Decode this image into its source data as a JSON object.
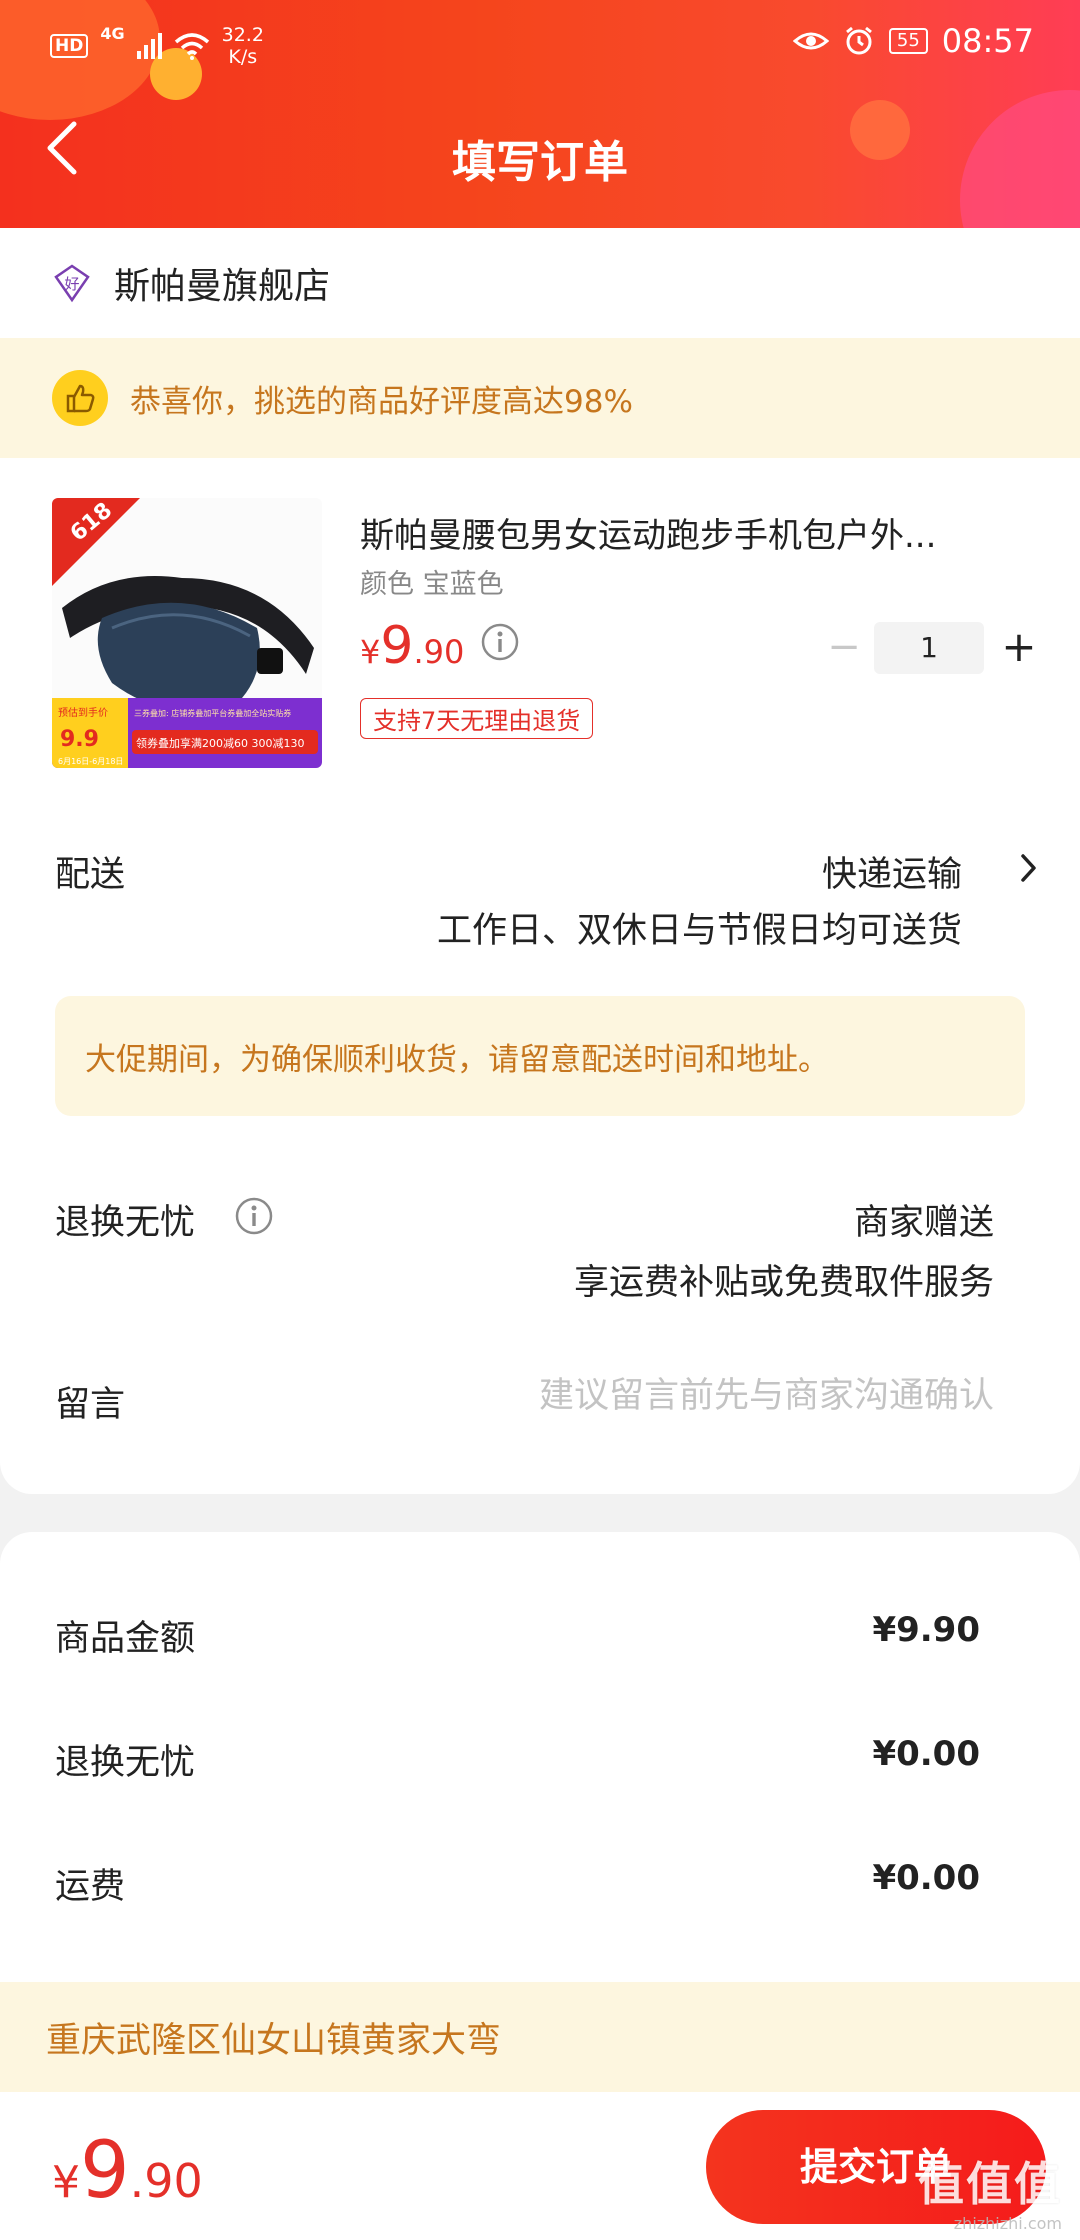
{
  "status_bar": {
    "hd": "HD",
    "network": "4G",
    "speed_value": "32.2",
    "speed_unit": "K/s",
    "battery": "55",
    "time": "08:57"
  },
  "nav": {
    "title": "填写订单"
  },
  "shop": {
    "name": "斯帕曼旗舰店",
    "badge_char": "好"
  },
  "praise": {
    "text": "恭喜你，挑选的商品好评度高达98%"
  },
  "product": {
    "title": "斯帕曼腰包男女运动跑步手机包户外...",
    "spec": "颜色 宝蓝色",
    "price_currency": "¥",
    "price_int": "9",
    "price_dec": ".90",
    "return_tag": "支持7天无理由退货",
    "quantity": "1",
    "image_texts": {
      "badge": "618",
      "deal_label": "预估到手价",
      "deal_price": "9.9",
      "banner_top": "三券叠加: 店铺券叠加平台券叠加全站实贴券",
      "banner_bottom": "领券叠加享满200减60 300减130",
      "dates": "6月16日-6月18日"
    }
  },
  "delivery": {
    "label": "配送",
    "value": "快递运输",
    "sub": "工作日、双休日与节假日均可送货",
    "notice": "大促期间，为确保顺利收货，请留意配送时间和地址。"
  },
  "returns": {
    "label": "退换无忧",
    "value": "商家赠送",
    "sub": "享运费补贴或免费取件服务"
  },
  "message": {
    "label": "留言",
    "placeholder": "建议留言前先与商家沟通确认"
  },
  "summary": [
    {
      "label": "商品金额",
      "value": "¥9.90"
    },
    {
      "label": "退换无忧",
      "value": "¥0.00"
    },
    {
      "label": "运费",
      "value": "¥0.00"
    }
  ],
  "address": {
    "text": "重庆武隆区仙女山镇黄家大弯"
  },
  "footer": {
    "total_currency": "¥",
    "total_int": "9",
    "total_dec": ".90",
    "submit_label": "提交订单",
    "watermark_big": "值值值",
    "watermark_small": "zhizhizhi.com"
  },
  "colors": {
    "accent_red": "#e4302a",
    "header_orange": "#f5451c",
    "notice_bg": "#fdf6df",
    "notice_text": "#c6761e"
  }
}
